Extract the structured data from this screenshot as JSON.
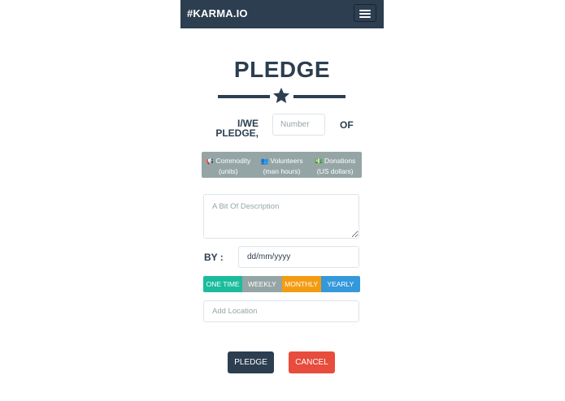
{
  "navbar": {
    "brand": "#KARMA.IO",
    "menu_icon": "hamburger-menu-icon",
    "bg_color": "#2c3e50"
  },
  "page": {
    "title": "PLEDGE",
    "divider_icon": "star-icon"
  },
  "pledge_row": {
    "prefix_line1": "I/WE",
    "prefix_line2": "PLEDGE,",
    "number_placeholder": "Number",
    "suffix": "OF"
  },
  "types": [
    {
      "icon": "megaphone-icon",
      "glyph": "📢",
      "label": "Commodity",
      "sublabel": "(units)"
    },
    {
      "icon": "users-icon",
      "glyph": "👥",
      "label": "Volunteers",
      "sublabel": "(man hours)"
    },
    {
      "icon": "money-icon",
      "glyph": "💵",
      "label": "Donations",
      "sublabel": "(US dollars)"
    }
  ],
  "description": {
    "placeholder": "A Bit Of Description"
  },
  "date_row": {
    "label": "BY :",
    "value": "dd/mm/yyyy"
  },
  "frequency": [
    {
      "label": "ONE TIME",
      "color": "#1abc9c"
    },
    {
      "label": "WEEKLY",
      "color": "#95a5a6"
    },
    {
      "label": "MONTHLY",
      "color": "#f39c12"
    },
    {
      "label": "YEARLY",
      "color": "#3498db"
    }
  ],
  "location": {
    "placeholder": "Add Location"
  },
  "actions": {
    "pledge_label": "PLEDGE",
    "cancel_label": "CANCEL",
    "pledge_color": "#2c3e50",
    "cancel_color": "#e74c3c"
  }
}
